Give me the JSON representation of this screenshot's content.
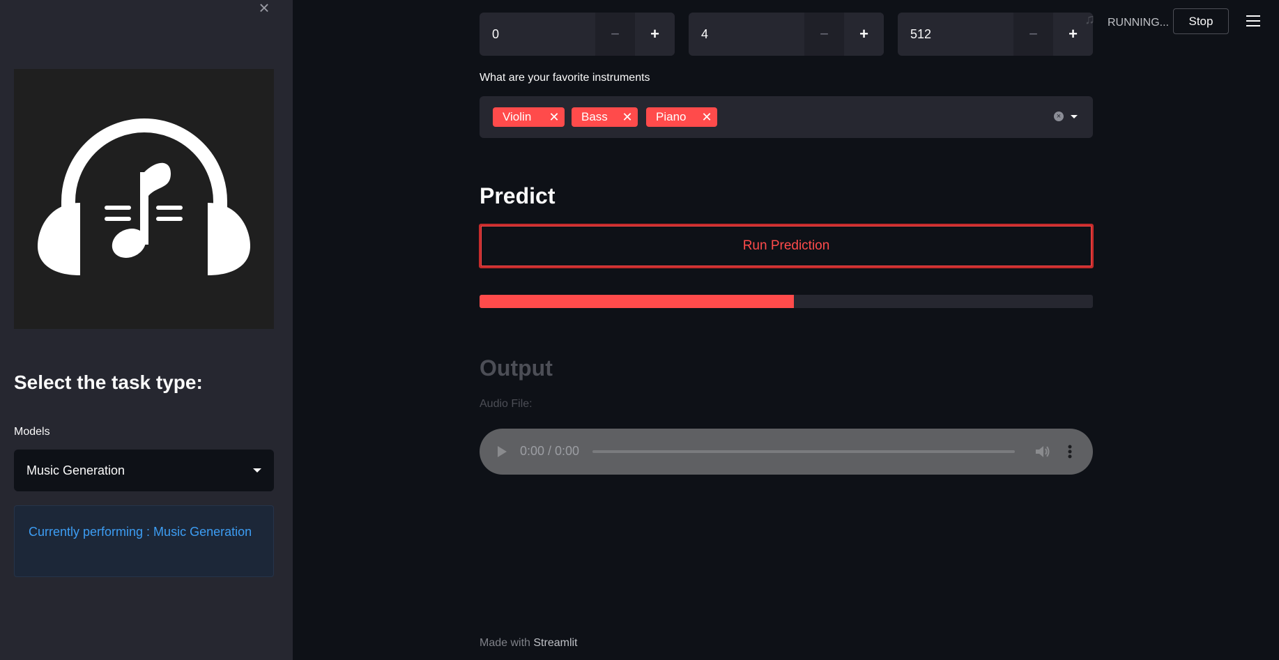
{
  "sidebar": {
    "close_glyph": "×",
    "logo": {
      "icon": "headphones-music-note-icon"
    },
    "heading": "Select the task type:",
    "models_label": "Models",
    "models_selected": "Music Generation",
    "info_text": "Currently performing : Music Generation"
  },
  "main": {
    "number_inputs": [
      {
        "value": "0",
        "minus": "−",
        "plus": "+"
      },
      {
        "value": "4",
        "minus": "−",
        "plus": "+"
      },
      {
        "value": "512",
        "minus": "−",
        "plus": "+"
      }
    ],
    "instruments_label": "What are your favorite instruments",
    "instruments": [
      {
        "label": "Violin",
        "remove": "✕"
      },
      {
        "label": "Bass",
        "remove": "✕"
      },
      {
        "label": "Piano",
        "remove": "✕"
      }
    ],
    "predict_heading": "Predict",
    "run_button": "Run Prediction",
    "progress_fraction": 0.513,
    "output_heading": "Output",
    "audio_label": "Audio File:",
    "audio_time": "0:00 / 0:00",
    "footer_prefix": "Made with ",
    "footer_brand": "Streamlit"
  },
  "topbar": {
    "status": "RUNNING...",
    "stop_button": "Stop"
  },
  "colors": {
    "accent": "#ff4b4b",
    "background": "#0e1117",
    "sidebar": "#262730",
    "info_text": "#3d9df3"
  }
}
